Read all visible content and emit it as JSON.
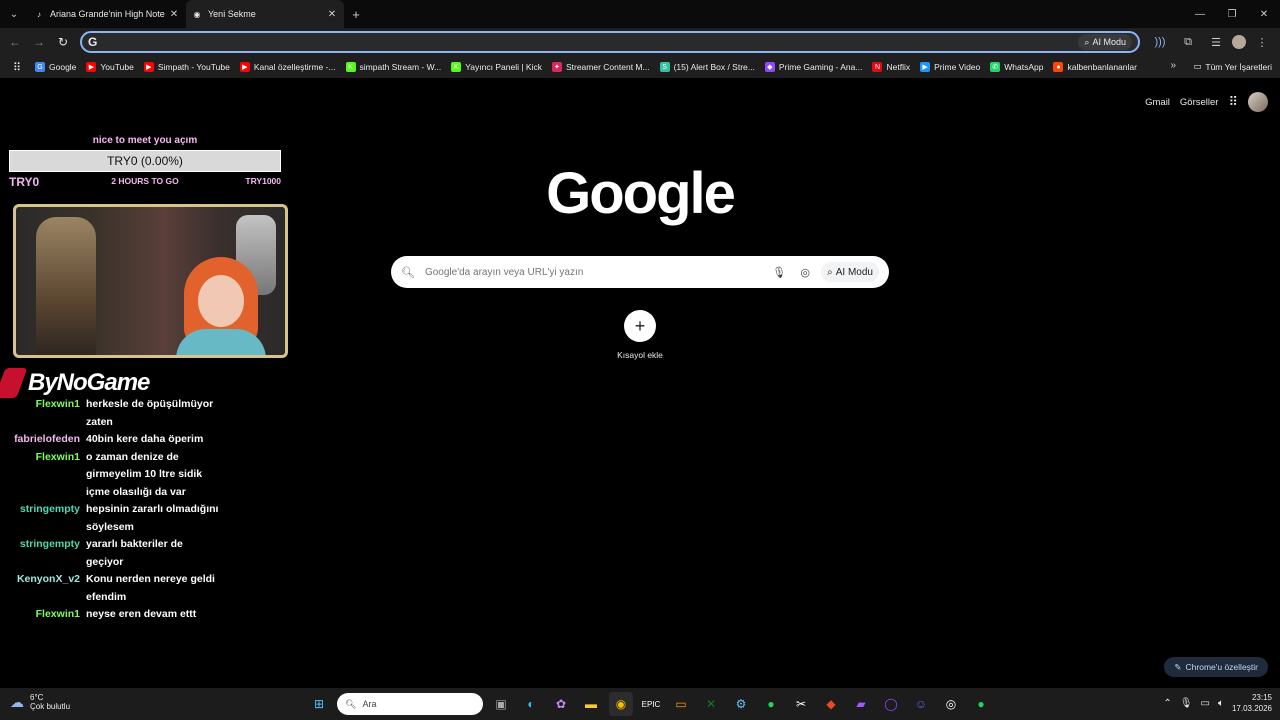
{
  "tabs": [
    {
      "title": "Ariana Grande'nin High Note Pe",
      "active": false
    },
    {
      "title": "Yeni Sekme",
      "active": true
    }
  ],
  "omnibox": {
    "value": "",
    "ai_label": "AI Modu"
  },
  "bookmarks": [
    {
      "label": "Google",
      "color": "#4285f4",
      "glyph": "G"
    },
    {
      "label": "YouTube",
      "color": "#ff0000",
      "glyph": "▶"
    },
    {
      "label": "Simpath - YouTube",
      "color": "#ff0000",
      "glyph": "▶"
    },
    {
      "label": "Kanal özelleştirme -...",
      "color": "#ff0000",
      "glyph": "▶"
    },
    {
      "label": "simpath Stream - W...",
      "color": "#53fc18",
      "glyph": "K"
    },
    {
      "label": "Yayıncı Paneli | Kick",
      "color": "#53fc18",
      "glyph": "K"
    },
    {
      "label": "Streamer Content M...",
      "color": "#e0245e",
      "glyph": "✦"
    },
    {
      "label": "(15) Alert Box / Stre...",
      "color": "#31c3a2",
      "glyph": "S"
    },
    {
      "label": "Prime Gaming - Ana...",
      "color": "#9146ff",
      "glyph": "◆"
    },
    {
      "label": "Netflix",
      "color": "#e50914",
      "glyph": "N"
    },
    {
      "label": "Prime Video",
      "color": "#1a98ff",
      "glyph": "▶"
    },
    {
      "label": "WhatsApp",
      "color": "#25d366",
      "glyph": "✆"
    },
    {
      "label": "kalbenbanlananlar",
      "color": "#ff4500",
      "glyph": "●"
    }
  ],
  "bookmarks_all": "Tüm Yer İşaretleri",
  "header": {
    "gmail": "Gmail",
    "images": "Görseller"
  },
  "logo": "Google",
  "search": {
    "placeholder": "Google'da arayın veya URL'yi yazın",
    "ai_label": "AI Modu"
  },
  "shortcut": {
    "label": "Kısayol ekle"
  },
  "customize": "Chrome'u özelleştir",
  "overlay": {
    "goal_title": "nice to meet you açım",
    "goal_bar": "TRY0 (0.00%)",
    "goal_progress": 0,
    "goal_min": "TRY0",
    "goal_time": "2 HOURS TO GO",
    "goal_max": "TRY1000",
    "sponsor": "ByNoGame"
  },
  "chat": [
    {
      "user": "Flexwin1",
      "color": "#7cff5a",
      "text": "herkesle de öpüşülmüyor zaten"
    },
    {
      "user": "fabrielofeden",
      "color": "#f5b8f0",
      "text": "40bin kere daha öperim"
    },
    {
      "user": "Flexwin1",
      "color": "#7cff5a",
      "text": "o zaman denize de girmeyelim 10 ltre sidik içme olasılığı da var"
    },
    {
      "user": "stringempty",
      "color": "#4ed8b0",
      "text": "hepsinin zararlı olmadığını söylesem"
    },
    {
      "user": "stringempty",
      "color": "#4ed8b0",
      "text": "yararlı bakteriler de geçiyor"
    },
    {
      "user": "KenyonX_v2",
      "color": "#9fe8e0",
      "text": "Konu nerden nereye geldi efendim"
    },
    {
      "user": "Flexwin1",
      "color": "#7cff5a",
      "text": "neyse eren devam ettt"
    }
  ],
  "taskbar": {
    "temp": "6°C",
    "weather": "Çok bulutlu",
    "search_placeholder": "Ara",
    "time": "23:15",
    "date": "17.03.2026"
  }
}
